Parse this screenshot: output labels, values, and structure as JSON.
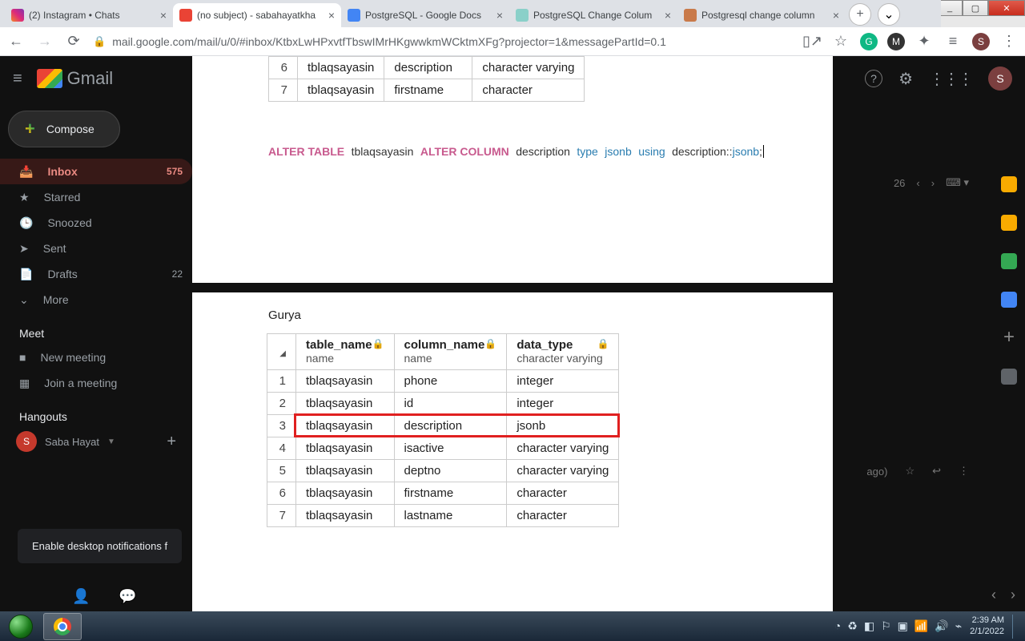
{
  "window": {
    "minimize": "_",
    "maximize": "▢",
    "close": "✕"
  },
  "tabs": [
    {
      "title": "(2) Instagram • Chats",
      "favcolor": "linear-gradient(45deg,#f58529,#dd2a7b,#8134af)"
    },
    {
      "title": "(no subject) - sabahayatkha",
      "favcolor": "#ea4335",
      "active": true
    },
    {
      "title": "PostgreSQL - Google Docs",
      "favcolor": "#4285f4"
    },
    {
      "title": "PostgreSQL Change Colum",
      "favcolor": "#8ad0c9"
    },
    {
      "title": "Postgresql change column",
      "favcolor": "#c97a4a"
    }
  ],
  "newtab": "+",
  "taboverflow": "⌄",
  "nav": {
    "back": "←",
    "fwd": "→",
    "reload": "⟳"
  },
  "url_host": "mail.google.com",
  "url_path": "/mail/u/0/#inbox/KtbxLwHPxvtfTbswIMrHKgwwkmWCktmXFg?projector=1&messagePartId=0.1",
  "addr_icons": {
    "share": "▯↗",
    "star": "☆"
  },
  "ext": {
    "grammarly": "G",
    "m": "M",
    "puzzle": "✦",
    "list": "≡",
    "avatar": "S",
    "menu": "⋮"
  },
  "gmail": {
    "brand": "Gmail",
    "header_icons": {
      "help": "?",
      "settings": "⚙",
      "apps": "⋮⋮⋮",
      "avatar": "S"
    },
    "compose": "Compose",
    "sidebar": [
      {
        "icon": "📥",
        "label": "Inbox",
        "count": "575",
        "active": true
      },
      {
        "icon": "★",
        "label": "Starred"
      },
      {
        "icon": "🕒",
        "label": "Snoozed"
      },
      {
        "icon": "➤",
        "label": "Sent"
      },
      {
        "icon": "📄",
        "label": "Drafts",
        "count": "22"
      },
      {
        "icon": "⌄",
        "label": "More"
      }
    ],
    "meet_title": "Meet",
    "meet": [
      {
        "icon": "■",
        "label": "New meeting"
      },
      {
        "icon": "▦",
        "label": "Join a meeting"
      }
    ],
    "hangouts_title": "Hangouts",
    "hangouts_user": "Saba Hayat",
    "hangouts_initial": "S",
    "toast": "Enable desktop notifications f",
    "pager_text": "26",
    "row_right": "ago)",
    "rail_colors": [
      "#f9ab00",
      "#f9ab00",
      "#34a853",
      "#4285f4",
      "",
      "#5f6368"
    ]
  },
  "overlay1": {
    "rows": [
      {
        "n": "6",
        "t": "tblaqsayasin",
        "c": "description",
        "d": "character varying"
      },
      {
        "n": "7",
        "t": "tblaqsayasin",
        "c": "firstname",
        "d": "character"
      }
    ],
    "sql": {
      "p1": "ALTER TABLE",
      "p2": "tblaqsayasin",
      "p3": "ALTER COLUMN",
      "p4": "description",
      "p5": "type",
      "p6": "jsonb",
      "p7": "using",
      "p8": "description::",
      "p9": "jsonb",
      "p10": ";"
    }
  },
  "overlay2": {
    "heading": "Gurya",
    "headers": {
      "c1a": "table_name",
      "c1b": "name",
      "c2a": "column_name",
      "c2b": "name",
      "c3a": "data_type",
      "c3b": "character varying"
    },
    "rows": [
      {
        "n": "1",
        "t": "tblaqsayasin",
        "c": "phone",
        "d": "integer"
      },
      {
        "n": "2",
        "t": "tblaqsayasin",
        "c": "id",
        "d": "integer"
      },
      {
        "n": "3",
        "t": "tblaqsayasin",
        "c": "description",
        "d": "jsonb",
        "hl": true
      },
      {
        "n": "4",
        "t": "tblaqsayasin",
        "c": "isactive",
        "d": "character varying"
      },
      {
        "n": "5",
        "t": "tblaqsayasin",
        "c": "deptno",
        "d": "character varying"
      },
      {
        "n": "6",
        "t": "tblaqsayasin",
        "c": "firstname",
        "d": "character"
      },
      {
        "n": "7",
        "t": "tblaqsayasin",
        "c": "lastname",
        "d": "character"
      }
    ]
  },
  "taskbar": {
    "time": "2:39 AM",
    "date": "2/1/2022",
    "tray_icons": [
      "◔",
      "♻",
      "◧",
      "⚐",
      "▣",
      "📶",
      "🔊",
      "⌁"
    ]
  }
}
